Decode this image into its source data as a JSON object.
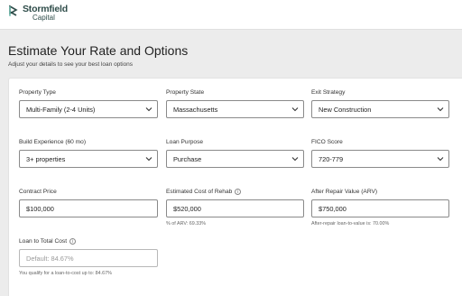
{
  "header": {
    "brand_name": "Stormfield",
    "brand_sub": "Capital"
  },
  "page": {
    "title": "Estimate Your Rate and Options",
    "subtitle": "Adjust your details to see your best loan options"
  },
  "fields": {
    "property_type": {
      "label": "Property Type",
      "value": "Multi-Family (2-4 Units)"
    },
    "property_state": {
      "label": "Property State",
      "value": "Massachusetts"
    },
    "exit_strategy": {
      "label": "Exit Strategy",
      "value": "New Construction"
    },
    "build_experience": {
      "label": "Build Experience (60 mo)",
      "value": "3+ properties"
    },
    "loan_purpose": {
      "label": "Loan Purpose",
      "value": "Purchase"
    },
    "fico_score": {
      "label": "FICO Score",
      "value": "720-779"
    },
    "contract_price": {
      "label": "Contract Price",
      "value": "$100,000"
    },
    "rehab_cost": {
      "label": "Estimated Cost of Rehab",
      "value": "$520,000",
      "hint": "% of ARV: 69.33%"
    },
    "arv": {
      "label": "After Repair Value (ARV)",
      "value": "$750,000",
      "hint": "After-repair loan-to-value is: 70.00%"
    },
    "ltc": {
      "label": "Loan to Total Cost",
      "placeholder": "Default: 84.67%",
      "hint": "You qualify for a loan-to-cost up to: 84.67%"
    }
  },
  "icons": {
    "chevron": "chevron-down-icon",
    "info": "info-icon"
  },
  "colors": {
    "brand": "#2f4d4a",
    "background": "#ececec",
    "card": "#ffffff"
  }
}
